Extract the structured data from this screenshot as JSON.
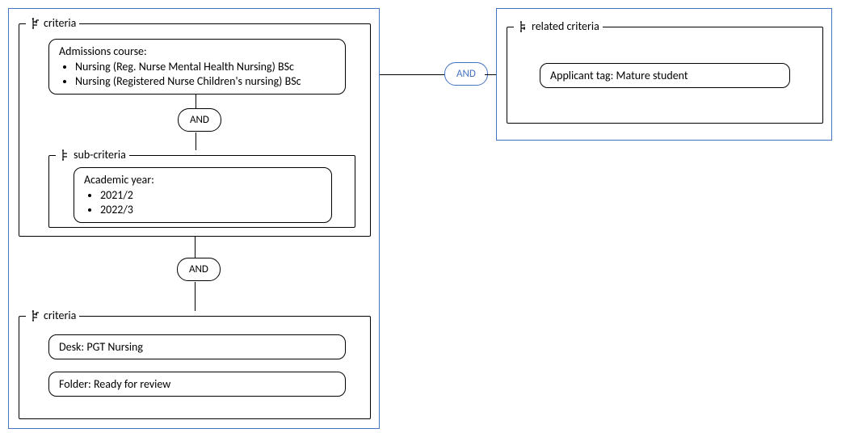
{
  "left_panel": {
    "group1": {
      "label": "criteria",
      "admissions": {
        "title": "Admissions course:",
        "items": [
          "Nursing (Reg. Nurse Mental Health Nursing) BSc",
          "Nursing (Registered Nurse Children's nursing) BSc"
        ]
      },
      "and1": "AND",
      "subgroup": {
        "label": "sub-criteria",
        "academic_year": {
          "title": "Academic year:",
          "items": [
            "2021/2",
            "2022/3"
          ]
        }
      }
    },
    "and_mid": "AND",
    "group2": {
      "label": "criteria",
      "desk": "Desk: PGT Nursing",
      "folder": "Folder: Ready for review"
    }
  },
  "center_and": "AND",
  "right_panel": {
    "group": {
      "label": "related criteria",
      "tag": "Applicant tag: Mature student"
    }
  }
}
